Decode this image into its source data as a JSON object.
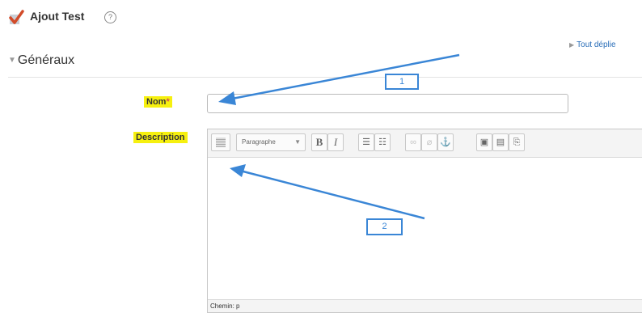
{
  "header": {
    "title": "Ajout Test",
    "help_icon": "help-circle-icon",
    "activity_icon": "checkmark-icon"
  },
  "expand_all": "Tout déplie",
  "section": {
    "title": "Généraux"
  },
  "fields": {
    "nom": {
      "label": "Nom",
      "required_marker": "*",
      "value": ""
    },
    "description": {
      "label": "Description"
    }
  },
  "editor": {
    "format_select": "Paragraphe",
    "bold": "B",
    "italic": "I",
    "statusbar": "Chemin: p"
  },
  "annotations": {
    "badge_1": "1",
    "badge_2": "2"
  },
  "colors": {
    "highlight": "#f6f00f",
    "annotation": "#3a86d6",
    "link": "#2a6eb8"
  }
}
